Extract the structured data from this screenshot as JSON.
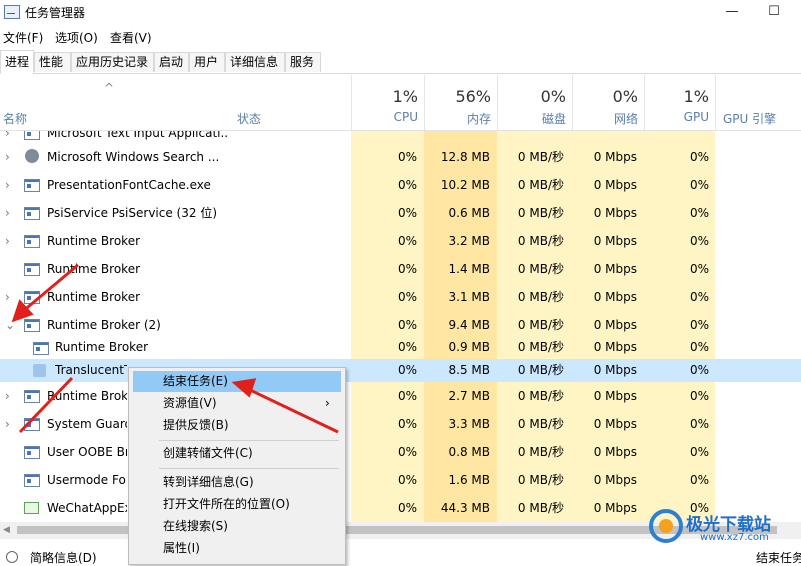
{
  "window": {
    "title": "任务管理器",
    "minimize": "—",
    "maximize": "☐"
  },
  "menu": [
    "文件(F)",
    "选项(O)",
    "查看(V)"
  ],
  "tabs": [
    "进程",
    "性能",
    "应用历史记录",
    "启动",
    "用户",
    "详细信息",
    "服务"
  ],
  "header": {
    "name_label": "名称",
    "status_label": "状态",
    "sort_glyph": "^",
    "cpu": {
      "pct": "1%",
      "label": "CPU"
    },
    "memory": {
      "pct": "56%",
      "label": "内存"
    },
    "disk": {
      "pct": "0%",
      "label": "磁盘"
    },
    "network": {
      "pct": "0%",
      "label": "网络"
    },
    "gpu": {
      "pct": "1%",
      "label": "GPU"
    },
    "gpu_engine_label": "GPU 引擎"
  },
  "processes": [
    {
      "name": "Microsoft Text Input Applicati...",
      "cpu": "",
      "mem": "",
      "disk": "",
      "net": "",
      "gpu": ""
    },
    {
      "name": "Microsoft Windows Search ...",
      "cpu": "0%",
      "mem": "12.8 MB",
      "disk": "0 MB/秒",
      "net": "0 Mbps",
      "gpu": "0%"
    },
    {
      "name": "PresentationFontCache.exe",
      "cpu": "0%",
      "mem": "10.2 MB",
      "disk": "0 MB/秒",
      "net": "0 Mbps",
      "gpu": "0%"
    },
    {
      "name": "PsiService PsiService (32 位)",
      "cpu": "0%",
      "mem": "0.6 MB",
      "disk": "0 MB/秒",
      "net": "0 Mbps",
      "gpu": "0%"
    },
    {
      "name": "Runtime Broker",
      "cpu": "0%",
      "mem": "3.2 MB",
      "disk": "0 MB/秒",
      "net": "0 Mbps",
      "gpu": "0%"
    },
    {
      "name": "Runtime Broker",
      "cpu": "0%",
      "mem": "1.4 MB",
      "disk": "0 MB/秒",
      "net": "0 Mbps",
      "gpu": "0%"
    },
    {
      "name": "Runtime Broker",
      "cpu": "0%",
      "mem": "3.1 MB",
      "disk": "0 MB/秒",
      "net": "0 Mbps",
      "gpu": "0%"
    },
    {
      "name": "Runtime Broker (2)",
      "cpu": "0%",
      "mem": "9.4 MB",
      "disk": "0 MB/秒",
      "net": "0 Mbps",
      "gpu": "0%"
    },
    {
      "name": "Runtime Broker",
      "cpu": "0%",
      "mem": "0.9 MB",
      "disk": "0 MB/秒",
      "net": "0 Mbps",
      "gpu": "0%"
    },
    {
      "name": "TranslucentT",
      "cpu": "0%",
      "mem": "8.5 MB",
      "disk": "0 MB/秒",
      "net": "0 Mbps",
      "gpu": "0%"
    },
    {
      "name": "Runtime Brok",
      "cpu": "0%",
      "mem": "2.7 MB",
      "disk": "0 MB/秒",
      "net": "0 Mbps",
      "gpu": "0%"
    },
    {
      "name": "System Guard",
      "cpu": "0%",
      "mem": "3.3 MB",
      "disk": "0 MB/秒",
      "net": "0 Mbps",
      "gpu": "0%"
    },
    {
      "name": "User OOBE Br",
      "cpu": "0%",
      "mem": "0.8 MB",
      "disk": "0 MB/秒",
      "net": "0 Mbps",
      "gpu": "0%"
    },
    {
      "name": "Usermode Fo",
      "cpu": "0%",
      "mem": "1.6 MB",
      "disk": "0 MB/秒",
      "net": "0 Mbps",
      "gpu": "0%"
    },
    {
      "name": "WeChatAppEx",
      "cpu": "0%",
      "mem": "44.3 MB",
      "disk": "0 MB/秒",
      "net": "0 Mbps",
      "gpu": "0%"
    }
  ],
  "context_menu": {
    "items": [
      "结束任务(E)",
      "资源值(V)",
      "提供反馈(B)",
      "创建转储文件(C)",
      "转到详细信息(G)",
      "打开文件所在的位置(O)",
      "在线搜索(S)",
      "属性(I)"
    ],
    "submenu_glyph": "›"
  },
  "footer": {
    "details": "简略信息(D)",
    "end_task": "结束任务"
  },
  "watermark": {
    "brand": "极光下载站",
    "url": "www.xz7.com"
  },
  "colors": {
    "cpu_col": "#fff4c4",
    "mem_col": "#ffe7a3",
    "selection": "#cce8ff",
    "menu_highlight": "#91c9f7",
    "arrow": "#e0201b"
  }
}
